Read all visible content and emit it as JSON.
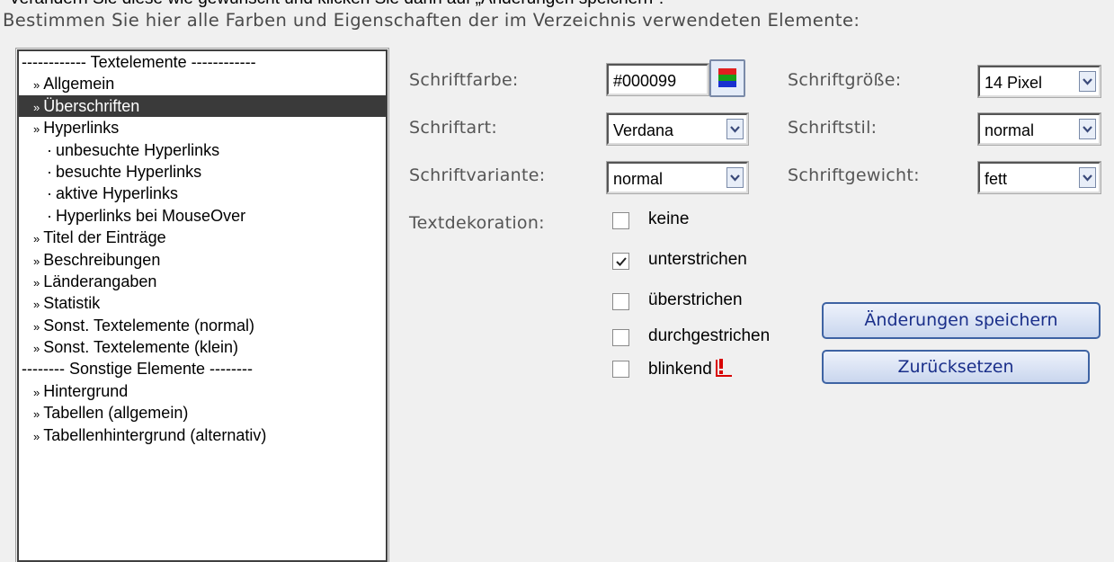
{
  "header": {
    "top_cut_text": "Verändern Sie diese wie gewünscht und klicken Sie dann auf „Änderungen speichern\".",
    "instruction": "Bestimmen Sie hier alle Farben und Eigenschaften der im Verzeichnis verwendeten Elemente:"
  },
  "list": {
    "items": [
      {
        "label": "------------ Textelemente ------------",
        "level": 0,
        "prefix": ""
      },
      {
        "label": "Allgemein",
        "level": 1,
        "prefix": "»"
      },
      {
        "label": "Überschriften",
        "level": 1,
        "prefix": "»",
        "selected": true
      },
      {
        "label": "Hyperlinks",
        "level": 1,
        "prefix": "»"
      },
      {
        "label": "unbesuchte Hyperlinks",
        "level": 2,
        "prefix": "·"
      },
      {
        "label": "besuchte Hyperlinks",
        "level": 2,
        "prefix": "·"
      },
      {
        "label": "aktive Hyperlinks",
        "level": 2,
        "prefix": "·"
      },
      {
        "label": "Hyperlinks bei MouseOver",
        "level": 2,
        "prefix": "·"
      },
      {
        "label": "Titel der Einträge",
        "level": 1,
        "prefix": "»"
      },
      {
        "label": "Beschreibungen",
        "level": 1,
        "prefix": "»"
      },
      {
        "label": "Länderangaben",
        "level": 1,
        "prefix": "»"
      },
      {
        "label": "Statistik",
        "level": 1,
        "prefix": "»"
      },
      {
        "label": "Sonst. Textelemente (normal)",
        "level": 1,
        "prefix": "»"
      },
      {
        "label": "Sonst. Textelemente (klein)",
        "level": 1,
        "prefix": "»"
      },
      {
        "label": "-------- Sonstige Elemente --------",
        "level": 0,
        "prefix": ""
      },
      {
        "label": "Hintergrund",
        "level": 1,
        "prefix": "»"
      },
      {
        "label": "Tabellen (allgemein)",
        "level": 1,
        "prefix": "»"
      },
      {
        "label": "Tabellenhintergrund (alternativ)",
        "level": 1,
        "prefix": "»"
      }
    ]
  },
  "form": {
    "font_color": {
      "label": "Schriftfarbe:",
      "value": "#000099"
    },
    "font_size": {
      "label": "Schriftgröße:",
      "value": "14 Pixel"
    },
    "font_family": {
      "label": "Schriftart:",
      "value": "Verdana"
    },
    "font_style": {
      "label": "Schriftstil:",
      "value": "normal"
    },
    "font_variant": {
      "label": "Schriftvariante:",
      "value": "normal"
    },
    "font_weight": {
      "label": "Schriftgewicht:",
      "value": "fett"
    },
    "text_decoration": {
      "label": "Textdekoration:",
      "options": [
        {
          "label": "keine",
          "checked": false
        },
        {
          "label": "unterstrichen",
          "checked": true
        },
        {
          "label": "überstrichen",
          "checked": false
        },
        {
          "label": "durchgestrichen",
          "checked": false
        },
        {
          "label": "blinkend",
          "checked": false
        }
      ]
    }
  },
  "buttons": {
    "save": "Änderungen speichern",
    "reset": "Zurücksetzen"
  },
  "icons": {
    "color_picker": "color-palette-icon",
    "warning": "warning-icon",
    "dropdown": "chevron-down-icon"
  },
  "colors": {
    "selected_row_bg": "#3a3a3a",
    "button_text": "#1a2f8a",
    "swatch_red": "#e02020",
    "swatch_green": "#18a018",
    "swatch_blue": "#1830d0",
    "warning": "#d80000"
  }
}
